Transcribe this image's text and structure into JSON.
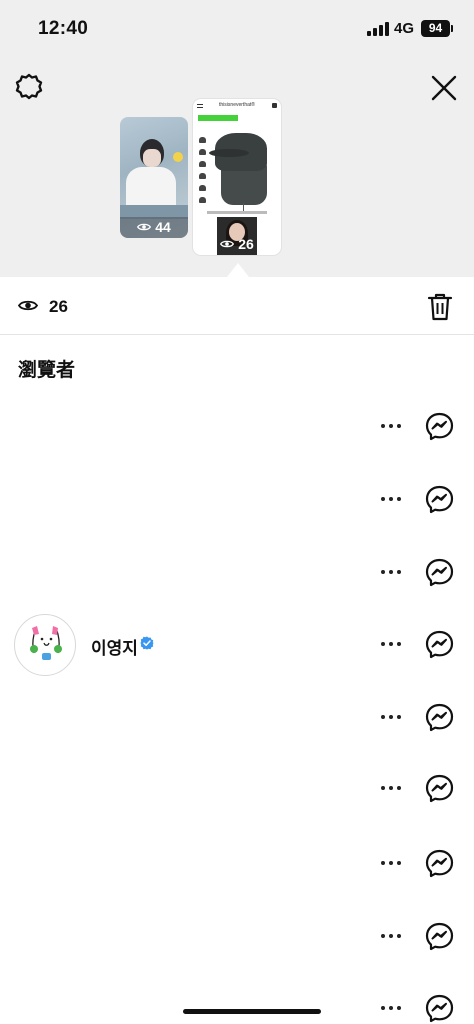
{
  "status_bar": {
    "time": "12:40",
    "network": "4G",
    "battery": "94"
  },
  "header": {
    "settings_icon": "gear-icon",
    "close_icon": "close-icon"
  },
  "stories": [
    {
      "views": "44",
      "selected": false
    },
    {
      "views": "26",
      "selected": true
    }
  ],
  "story_preview_text": {
    "brand": "thisisneverthat®"
  },
  "stats": {
    "views": "26",
    "delete_icon": "trash-icon"
  },
  "viewers_section": {
    "title": "瀏覽者"
  },
  "viewers": [
    {
      "name": "",
      "verified": false
    },
    {
      "name": "",
      "verified": false
    },
    {
      "name": "",
      "verified": false
    },
    {
      "name": "이영지",
      "verified": true
    },
    {
      "name": "",
      "verified": false
    },
    {
      "name": "",
      "verified": false
    },
    {
      "name": "",
      "verified": false
    },
    {
      "name": "",
      "verified": false
    },
    {
      "name": "",
      "verified": false
    }
  ],
  "colors": {
    "top_background": "#efefef",
    "verified_blue": "#3897f0",
    "text": "#111111"
  }
}
